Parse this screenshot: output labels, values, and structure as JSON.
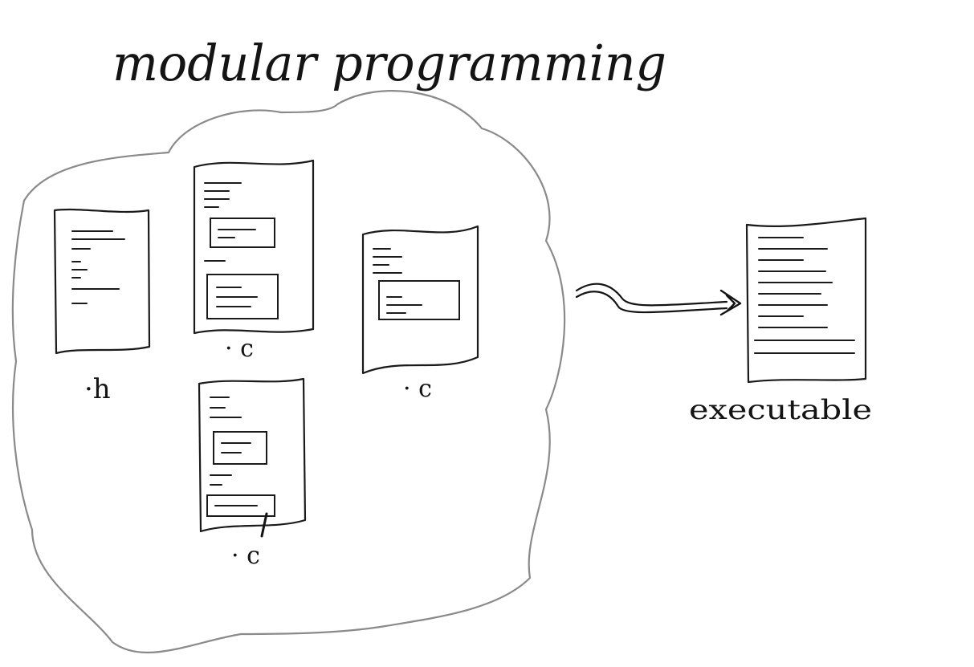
{
  "diagram": {
    "title": "modular programming",
    "files": [
      {
        "id": "header-file",
        "label": "·h"
      },
      {
        "id": "source-file-top",
        "label": "· c"
      },
      {
        "id": "source-file-bottom",
        "label": "· c"
      },
      {
        "id": "source-file-right",
        "label": "· c"
      }
    ],
    "output": {
      "label": "executable"
    }
  }
}
